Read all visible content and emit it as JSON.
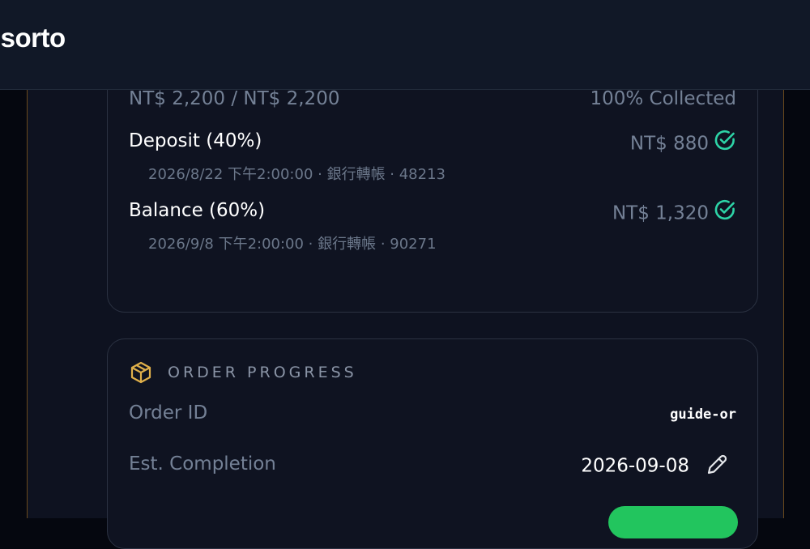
{
  "app": {
    "brand": "isorto"
  },
  "payment": {
    "summary_amount": "NT$ 2,200 / NT$ 2,200",
    "summary_status": "100% Collected",
    "items": [
      {
        "label": "Deposit (40%)",
        "amount": "NT$ 880",
        "detail": "2026/8/22 下午2:00:00 · 銀行轉帳 · 48213",
        "status_icon": "check-circle-icon"
      },
      {
        "label": "Balance (60%)",
        "amount": "NT$ 1,320",
        "detail": "2026/9/8 下午2:00:00 · 銀行轉帳 · 90271",
        "status_icon": "check-circle-icon"
      }
    ]
  },
  "order_progress": {
    "title": "ORDER PROGRESS",
    "icon": "package-icon",
    "order_id_label": "Order ID",
    "order_id_value": "guide-or",
    "est_completion_label": "Est. Completion",
    "est_completion_value": "2026-09-08",
    "edit_icon": "pencil-icon"
  },
  "colors": {
    "accent_green": "#22c55e",
    "check_teal": "#2dd4a7",
    "package_gold": "#e0b04a",
    "frame_border": "#6b4a1c"
  }
}
